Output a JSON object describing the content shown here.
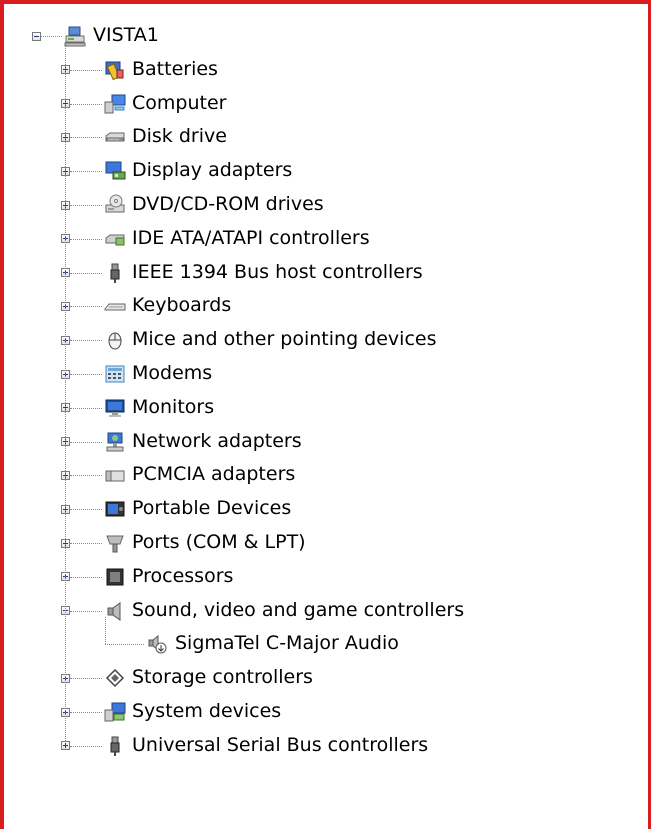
{
  "tree": {
    "root": {
      "label": "VISTA1",
      "icon": "computer-network-icon",
      "expanded": true
    },
    "categories": [
      {
        "label": "Batteries",
        "icon": "battery-icon",
        "expanded": false
      },
      {
        "label": "Computer",
        "icon": "computer-icon",
        "expanded": false
      },
      {
        "label": "Disk drive",
        "icon": "disk-drive-icon",
        "expanded": false
      },
      {
        "label": "Display adapters",
        "icon": "display-adapter-icon",
        "expanded": false
      },
      {
        "label": "DVD/CD-ROM drives",
        "icon": "dvd-drive-icon",
        "expanded": false
      },
      {
        "label": "IDE ATA/ATAPI controllers",
        "icon": "ide-controller-icon",
        "expanded": false
      },
      {
        "label": "IEEE 1394 Bus host controllers",
        "icon": "firewire-icon",
        "expanded": false
      },
      {
        "label": "Keyboards",
        "icon": "keyboard-icon",
        "expanded": false
      },
      {
        "label": "Mice and other pointing devices",
        "icon": "mouse-icon",
        "expanded": false
      },
      {
        "label": "Modems",
        "icon": "modem-icon",
        "expanded": false
      },
      {
        "label": "Monitors",
        "icon": "monitor-icon",
        "expanded": false
      },
      {
        "label": "Network adapters",
        "icon": "network-adapter-icon",
        "expanded": false
      },
      {
        "label": "PCMCIA adapters",
        "icon": "pcmcia-icon",
        "expanded": false
      },
      {
        "label": "Portable Devices",
        "icon": "portable-device-icon",
        "expanded": false
      },
      {
        "label": "Ports (COM & LPT)",
        "icon": "port-icon",
        "expanded": false
      },
      {
        "label": "Processors",
        "icon": "processor-icon",
        "expanded": false
      },
      {
        "label": "Sound, video and game controllers",
        "icon": "speaker-icon",
        "expanded": true,
        "children": [
          {
            "label": "SigmaTel C-Major Audio",
            "icon": "audio-device-icon"
          }
        ]
      },
      {
        "label": "Storage controllers",
        "icon": "storage-controller-icon",
        "expanded": false
      },
      {
        "label": "System devices",
        "icon": "system-device-icon",
        "expanded": false
      },
      {
        "label": "Universal Serial Bus controllers",
        "icon": "usb-icon",
        "expanded": false
      }
    ]
  },
  "colors": {
    "frame_border": "#d81e1e",
    "tree_lines": "#8a8a8a",
    "text": "#000000",
    "background": "#ffffff"
  }
}
